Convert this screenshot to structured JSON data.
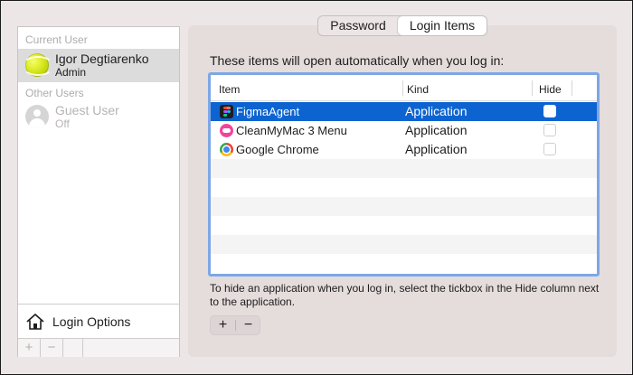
{
  "colors": {
    "window_bg": "#ede6e6",
    "panel_bg": "#e5dcdc",
    "selection": "#0d64d1",
    "focus_ring": "#7da7e6"
  },
  "sidebar": {
    "current_user_header": "Current User",
    "current_user": {
      "name": "Igor Degtiarenko",
      "role": "Admin",
      "avatar_icon": "tennis-ball-avatar"
    },
    "other_users_header": "Other Users",
    "other_users": [
      {
        "name": "Guest User",
        "status": "Off",
        "avatar_icon": "person-silhouette-avatar"
      }
    ],
    "login_options_label": "Login Options",
    "login_options_icon": "house-icon",
    "add_label": "+",
    "remove_label": "−"
  },
  "tabs": [
    {
      "label": "Password",
      "selected": false
    },
    {
      "label": "Login Items",
      "selected": true
    }
  ],
  "main": {
    "intro": "These items will open automatically when you log in:",
    "table": {
      "columns": [
        "Item",
        "Kind",
        "Hide"
      ],
      "rows": [
        {
          "name": "FigmaAgent",
          "kind": "Application",
          "hide": false,
          "selected": true,
          "icon": "figma-icon"
        },
        {
          "name": "CleanMyMac 3 Menu",
          "kind": "Application",
          "hide": false,
          "selected": false,
          "icon": "cleanmymac-icon"
        },
        {
          "name": "Google Chrome",
          "kind": "Application",
          "hide": false,
          "selected": false,
          "icon": "chrome-icon"
        }
      ]
    },
    "help_text": "To hide an application when you log in, select the tickbox in the Hide column next to the application.",
    "add_label": "+",
    "remove_label": "−"
  }
}
